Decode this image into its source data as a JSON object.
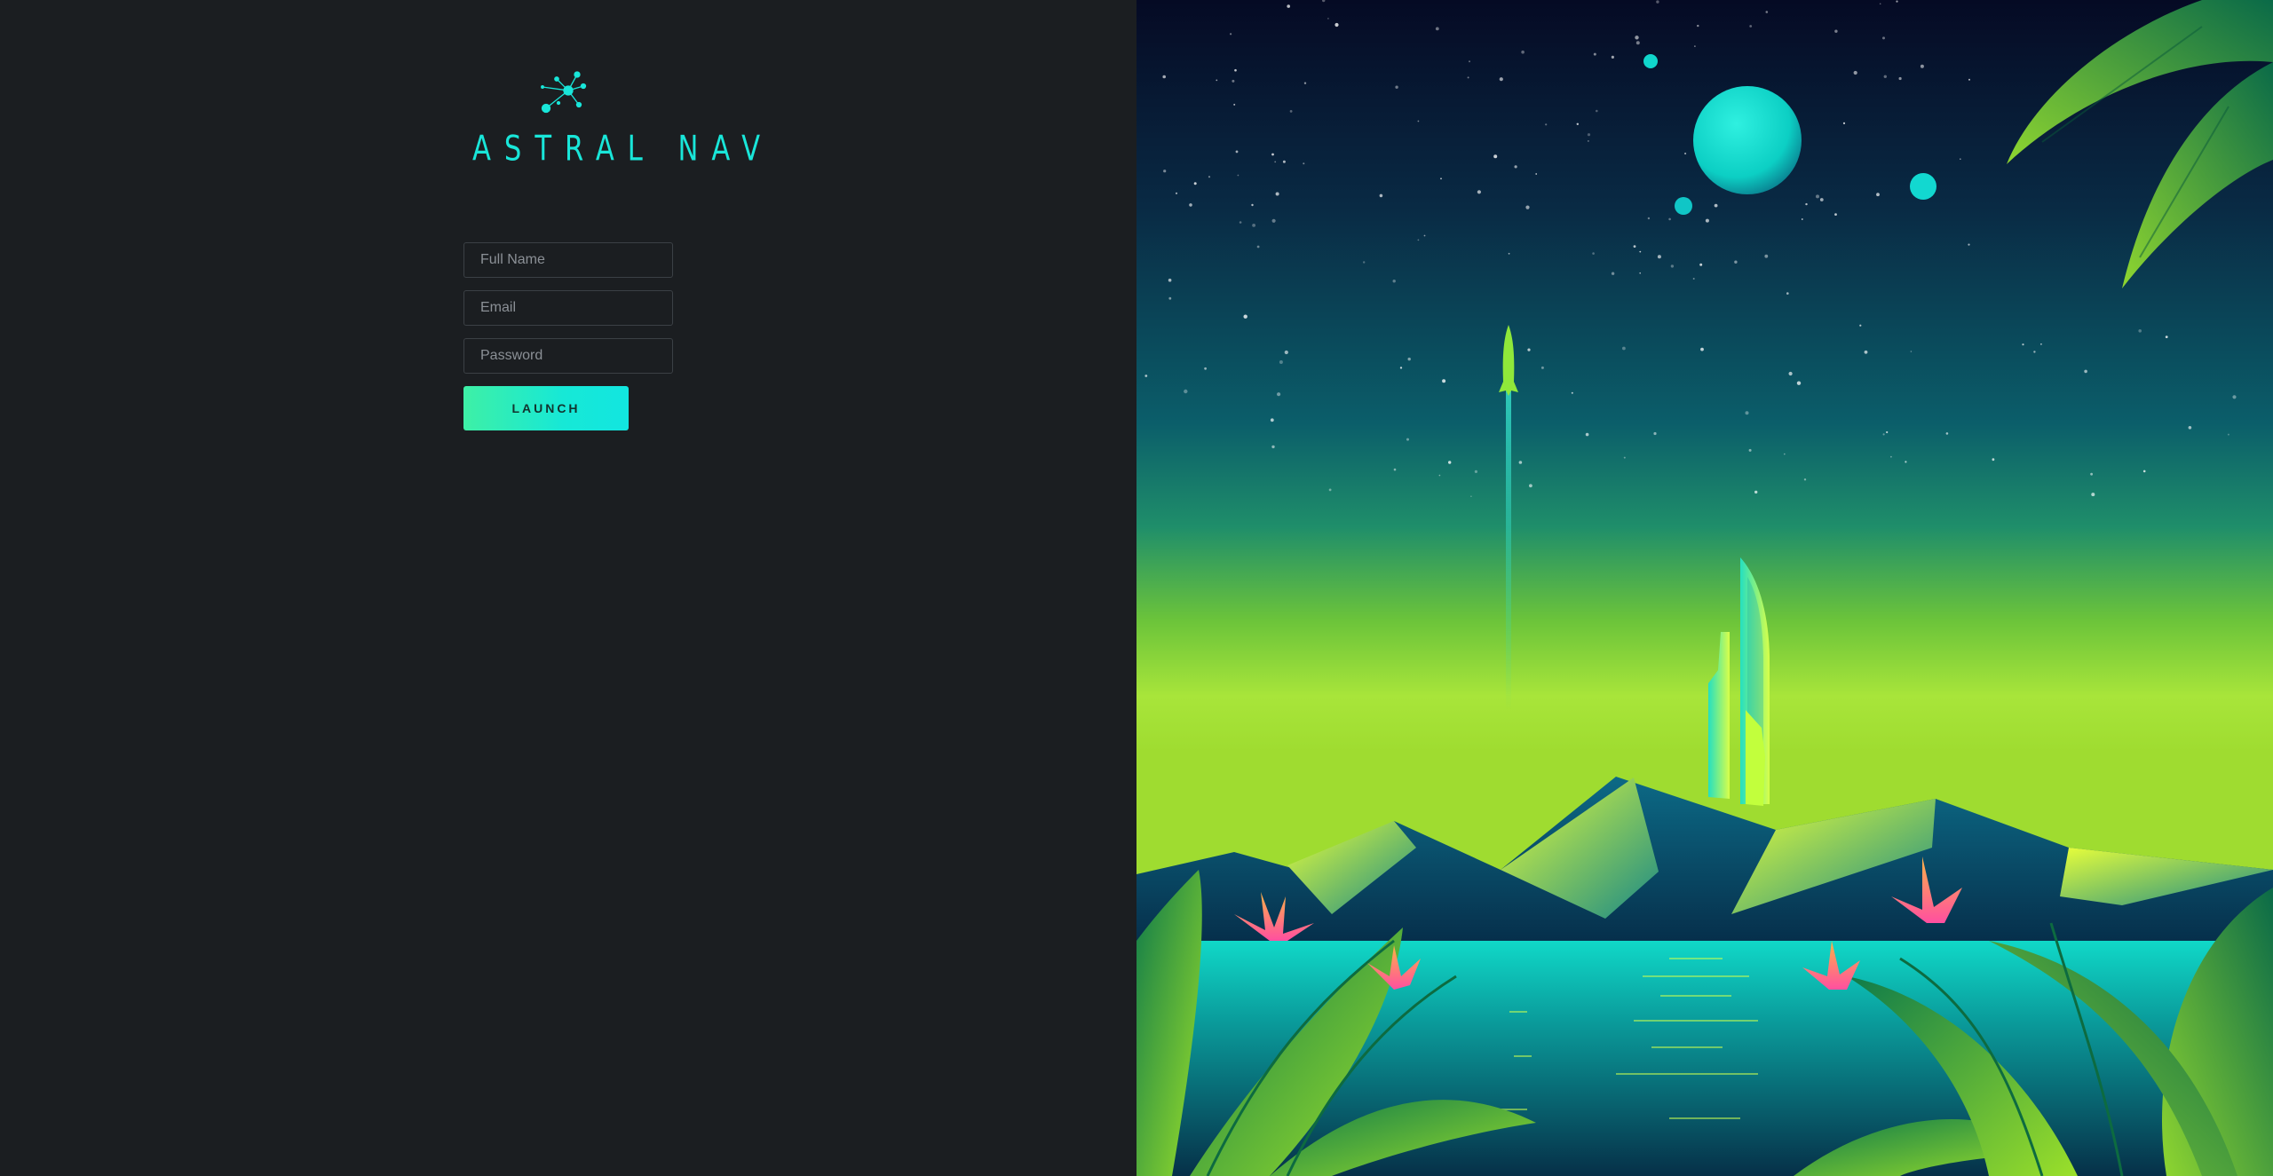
{
  "app": {
    "name": "ASTRAL NAV",
    "logo_icon": "constellation-icon"
  },
  "form": {
    "full_name_placeholder": "Full Name",
    "email_placeholder": "Email",
    "password_placeholder": "Password",
    "submit_label": "LAUNCH"
  },
  "colors": {
    "accent": "#19e6d9",
    "panel_bg": "#1b1e21",
    "button_gradient_start": "#3ef0a6",
    "button_gradient_end": "#12e6e0"
  },
  "illustration": {
    "name": "retro-futuristic-landscape"
  }
}
